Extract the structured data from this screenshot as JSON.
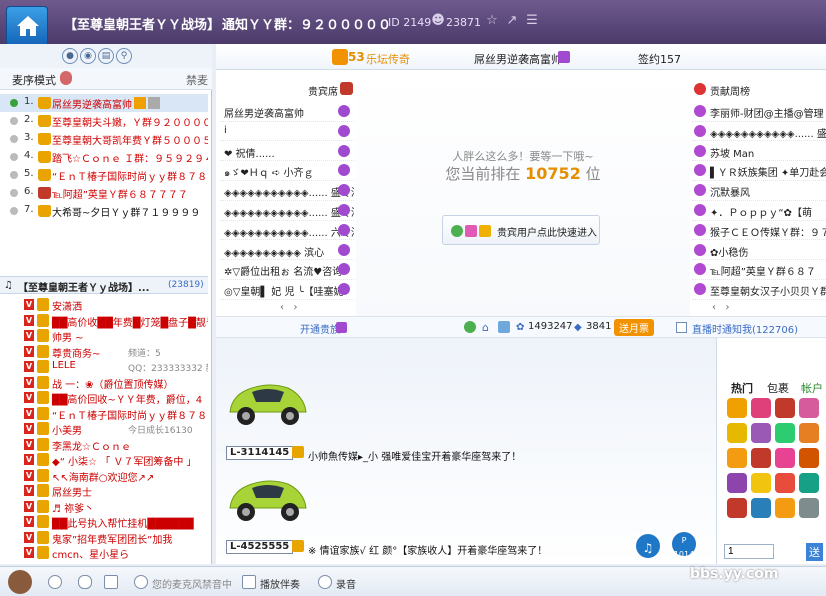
{
  "titlebar": {
    "room_name": "【至尊皇朝王者ＹＹ战场】",
    "notice": "通知ＹＹ群：９２０００００",
    "id_label": "ID 2149",
    "online_count": "23871"
  },
  "left": {
    "mode_label": "麦序模式",
    "mode_right": "禁麦",
    "queue": [
      {
        "num": "1.",
        "name": "屌丝男逆袭高富帅"
      },
      {
        "num": "2.",
        "name": "至尊皇朝夫斗嫩，Ｙ群９２００００"
      },
      {
        "num": "3.",
        "name": "至尊皇朝大哥凯年费Ｙ群５０００５"
      },
      {
        "num": "4.",
        "name": "踏飞☆Ｃｏｎｅ Ｉ群：９５９２９４"
      },
      {
        "num": "5.",
        "name": "“ＥｎＴ椿子国际时尚ｙｙ群８７８"
      },
      {
        "num": "6.",
        "name": "℡阿超”英皇Ｙ群６８７７７７"
      },
      {
        "num": "7.",
        "name": "大希哥~夕日Ｙｙ群７１９９９９"
      }
    ],
    "channel_title": "【至尊皇朝王者Ｙｙ战场】...",
    "channel_count": "(23819)",
    "members": [
      {
        "name": "安潇洒"
      },
      {
        "name": "██高价收██年费█灯笼█盘子█靓号"
      },
      {
        "name": "帅男 ~"
      },
      {
        "name": "尊贵商务~",
        "extra": "频道：5"
      },
      {
        "name": "LELE",
        "extra": "QQ：233333332  新QQ"
      },
      {
        "name": "战 一：❀（爵位置顶传媒）"
      },
      {
        "name": "██高价回收~ＹＹ年费，爵位，4"
      },
      {
        "name": "“ＥｎＴ椿子国际时尚ｙｙ群８７８"
      },
      {
        "name": "小美男",
        "extra": "今日成长16130"
      },
      {
        "name": "李黑龙☆Ｃｏｎｅ"
      },
      {
        "name": "◆“ 小柒☆ 「 Ｖ７军团筹备中 」"
      },
      {
        "name": "↖↖海南群○欢迎您↗↗"
      },
      {
        "name": "屌丝男士"
      },
      {
        "name": "♬               祢爹丶"
      },
      {
        "name": "██此号执入帮忙挂机██████"
      },
      {
        "name": "鬼家”招年费军团团长”加我"
      },
      {
        "name": "cmcn、星小星ら"
      }
    ]
  },
  "top": {
    "rank_num": "53",
    "rank_label": "乐坛传奇",
    "host_name": "屌丝男逆袭高富帅",
    "sign_label": "签约157"
  },
  "guests": {
    "title": "贵宾席",
    "rows": [
      "屌丝男逆袭高富帅",
      "i",
      "❤ 祝倩......",
      "๑ゞ❤Ｈｑ ➪ 小齐ｇ",
      "◈◈◈◈◈◈◈◈◈◈◈...... 盛专治",
      "◈◈◈◈◈◈◈◈◈◈◈...... 盛专治",
      "◈◈◈◈◈◈◈◈◈◈◈...... 六专治",
      "◈◈◈◈◈◈◈◈◈◈ 滨心",
      "✲▽爵位出租ぉ 名流♥咨询",
      "◎▽皇朝▌ 妃 児 ╰【哇塞妮"
    ]
  },
  "contrib": {
    "title": "贡献周榜",
    "rows": [
      "李丽师-财团@主播@管理",
      "◈◈◈◈◈◈◈◈◈◈◈...... 盛专治",
      "苏坡 Man",
      "▌ＹＲ妖族集团 ✦单刀赴会",
      "沉默暴风",
      "✦．Ｐｏｐｐｙ“✿【萌",
      "猴子ＣＥＯ传媒Ｙ群：９７",
      "✿小稳伤",
      "℡阿超”英皇Ｙ群６８７",
      "至尊皇朝女汉子小贝贝Ｙ群"
    ]
  },
  "waiting": {
    "line1": "人胖么这么多！要等一下哦~",
    "line2_prefix": "您当前排在",
    "position": "10752",
    "line2_suffix": "位",
    "vip_button": "贵宾用户点此快速进入"
  },
  "footer": {
    "open_vip": "开通贵族",
    "stat1": "1493247",
    "stat2": "3841",
    "song_btn": "送月票",
    "live_label": "直播时通知我(122706)"
  },
  "chat": {
    "tag1": "L-3114145",
    "msg1": "小帅魚传媒▸_小 强唯爱佳宝开着豪华座驾来了！",
    "tag2": "L-4525555",
    "msg2": "※ 情谊家族√ 红 颜°【家族收人】开着豪华座驾来了！",
    "fab2": "1014"
  },
  "emoji": {
    "tabs": [
      "热门",
      "包裹",
      "帐户"
    ],
    "count_value": "1",
    "send_label": "送"
  },
  "bottom": {
    "forbid_label": "您的麦克风禁音中",
    "accomp_label": "播放伴奏",
    "record_label": "录音",
    "watermark": "bbs.yy.com"
  }
}
